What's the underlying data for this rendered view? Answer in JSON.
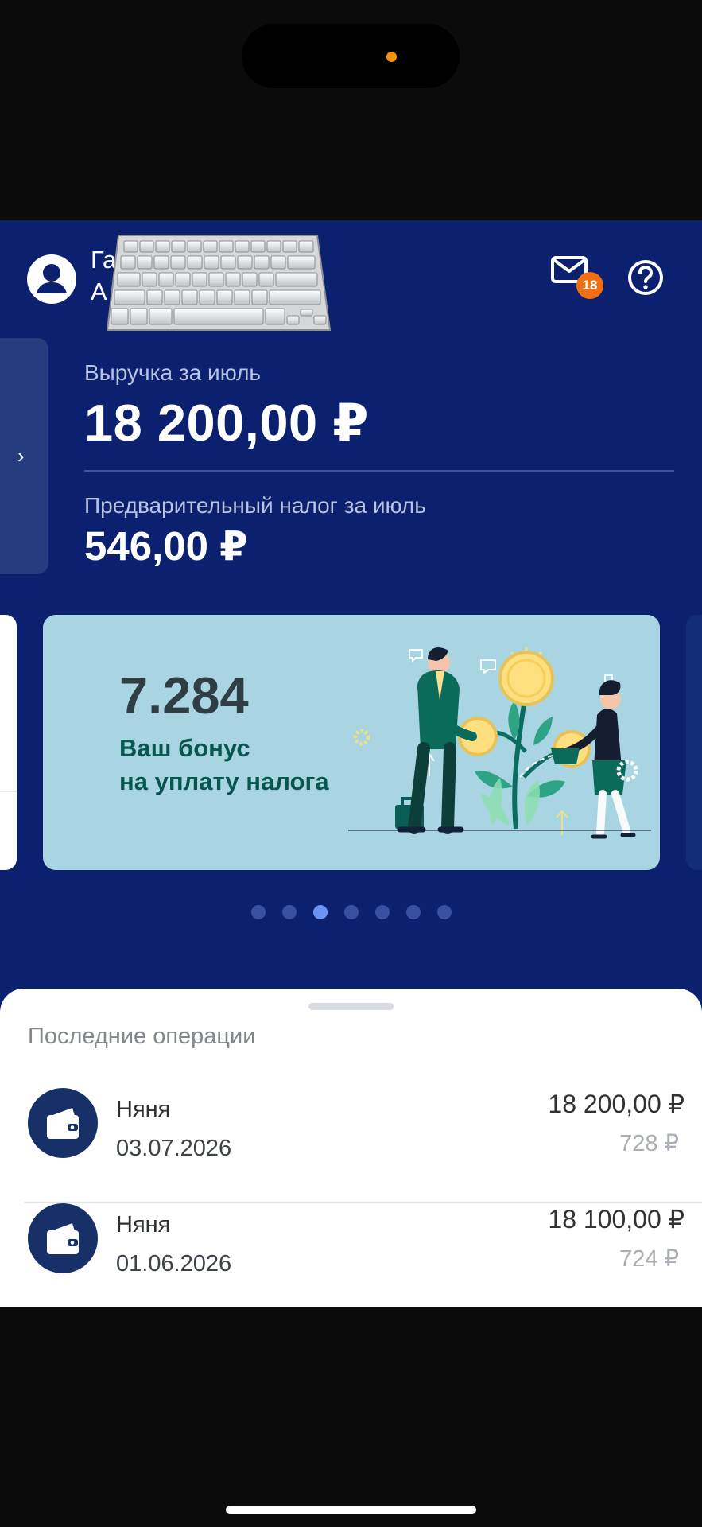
{
  "header": {
    "user_name_line1": "Га                  инат",
    "user_name_line2": "А",
    "notifications_count": "18"
  },
  "summary": {
    "revenue_label": "Выручка за июль",
    "revenue_value": "18 200,00 ₽",
    "tax_label": "Предварительный налог за июль",
    "tax_value": "546,00 ₽"
  },
  "carousel": {
    "promo_number": "7.284",
    "promo_text": "Ваш бонус\nна уплату налога",
    "page_count": 7,
    "active_index": 2
  },
  "operations": {
    "title": "Последние операции",
    "items": [
      {
        "name": "Няня",
        "date": "03.07.2026",
        "amount": "18 200,00 ₽",
        "tax": "728 ₽"
      },
      {
        "name": "Няня",
        "date": "01.06.2026",
        "amount": "18 100,00 ₽",
        "tax": "724 ₽"
      }
    ]
  },
  "icons": {
    "avatar": "user-icon",
    "mail": "mail-icon",
    "help": "help-icon",
    "operation": "wallet-icon",
    "side": "chevron-right-icon"
  },
  "colors": {
    "header_background": "#0c2070",
    "accent_badge": "#ef6f12",
    "promo_background": "#a9d5e2",
    "promo_text": "#07574e",
    "active_dot": "#6b93f4"
  }
}
